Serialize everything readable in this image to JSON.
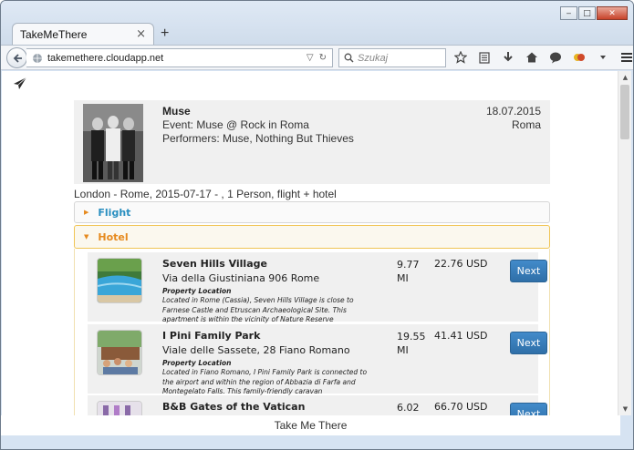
{
  "window": {
    "buttons": {
      "minimize": "‒",
      "maximize": "□",
      "close": "✕"
    }
  },
  "tab": {
    "title": "TakeMeThere",
    "close": "×",
    "new_tab": "+"
  },
  "address_bar": {
    "url": "takemethere.cloudapp.net"
  },
  "search_bar": {
    "placeholder": "Szukaj"
  },
  "toolbar": {
    "icons": [
      "star-icon",
      "reading-list-icon",
      "download-icon",
      "home-icon",
      "chat-icon",
      "extension-icon",
      "menu-icon"
    ]
  },
  "event": {
    "artist": "Muse",
    "event_line": "Event: Muse @ Rock in Roma",
    "performers_line": "Performers: Muse, Nothing But Thieves",
    "date": "18.07.2015",
    "city": "Roma"
  },
  "trip_summary": "London - Rome, 2015-07-17 - , 1 Person, flight + hotel",
  "sections": {
    "flight": {
      "label": "Flight",
      "expanded": false
    },
    "hotel": {
      "label": "Hotel",
      "expanded": true
    }
  },
  "hotels": [
    {
      "name": "Seven Hills Village",
      "address": "Via della Giustiniana 906 Rome",
      "location_title": "Property Location",
      "description": "Located in Rome (Cassia), Seven Hills Village is close to Farnese Castle and Etruscan Archaeological Site. This apartment is within the vicinity of Nature Reserve",
      "distance": "9.77 MI",
      "price": "22.76 USD",
      "button": "Next"
    },
    {
      "name": "I Pini Family Park",
      "address": "Viale delle Sassete, 28 Fiano Romano",
      "location_title": "Property Location",
      "description": "Located in Fiano Romano, I Pini Family Park is connected to the airport and within the region of Abbazia di Farfa and Montegelato Falls. This family-friendly caravan",
      "distance": "19.55 MI",
      "price": "41.41 USD",
      "button": "Next"
    },
    {
      "name": "B&B Gates of the Vatican",
      "address": "",
      "location_title": "",
      "description": "",
      "distance": "6.02",
      "price": "66.70 USD",
      "button": "Next"
    }
  ],
  "footer": {
    "text": "Take Me There"
  },
  "colors": {
    "accent_blue": "#2a8fc0",
    "accent_orange": "#e68a1e",
    "button_blue": "#428bca",
    "card_gray": "#f0f0f0"
  }
}
